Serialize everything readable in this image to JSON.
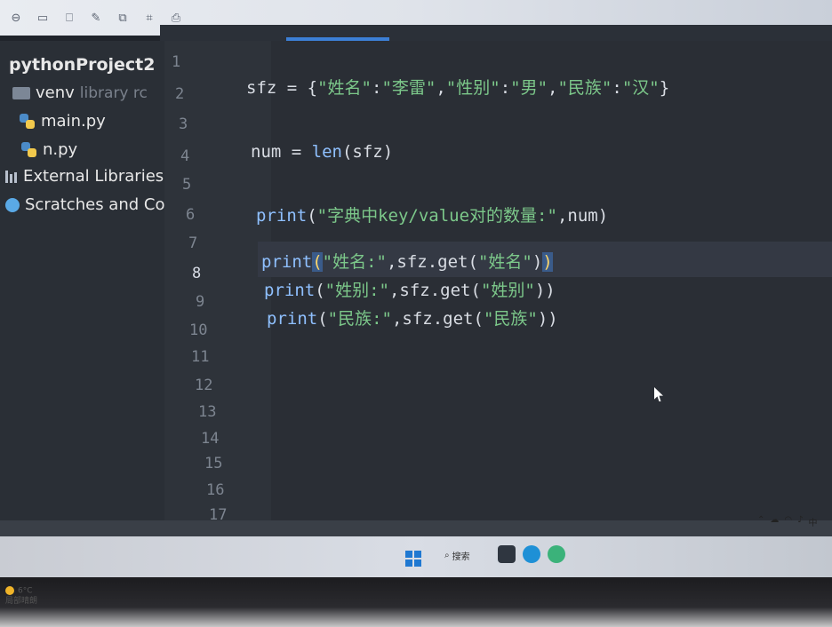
{
  "sidebar": {
    "project": "pythonProject2",
    "items": [
      {
        "label": "venv",
        "hint": "library rc",
        "icon": "folder-icon"
      },
      {
        "label": "main.py",
        "icon": "python-file-icon"
      },
      {
        "label": "n.py",
        "icon": "python-file-icon"
      },
      {
        "label": "External Libraries",
        "icon": "library-icon"
      },
      {
        "label": "Scratches and Co",
        "icon": "scratches-icon"
      }
    ]
  },
  "editor": {
    "line_numbers": [
      "1",
      "2",
      "3",
      "4",
      "5",
      "6",
      "7",
      "8",
      "9",
      "10",
      "11",
      "12",
      "13",
      "14",
      "15",
      "16",
      "17"
    ],
    "active_line": "8",
    "code": {
      "line2": {
        "var": "sfz",
        "op": " = ",
        "open": "{",
        "k1": "\"姓名\"",
        "c1": ":",
        "v1": "\"李雷\"",
        "s1": ",",
        "k2": "\"性别\"",
        "c2": ":",
        "v2": "\"男\"",
        "s2": ",",
        "k3": "\"民族\"",
        "c3": ":",
        "v3": "\"汉\"",
        "close": "}"
      },
      "line4": {
        "var": "num",
        "op": " = ",
        "fn": "len",
        "args": "(sfz)"
      },
      "line6": {
        "fn": "print",
        "open": "(",
        "str": "\"字典中key/value对的数量:\"",
        "rest": ",num)"
      },
      "line8": {
        "fn": "print",
        "open": "(",
        "str": "\"姓名:\"",
        "mid": ",sfz.get(",
        "arg": "\"姓名\"",
        "close1": ")",
        "close2": ")"
      },
      "line9": {
        "fn": "print",
        "open": "(",
        "str": "\"姓别:\"",
        "mid": ",sfz.get(",
        "arg": "\"姓别\"",
        "close": "))"
      },
      "line10": {
        "fn": "print",
        "open": "(",
        "str": "\"民族:\"",
        "mid": ",sfz.get(",
        "arg": "\"民族\"",
        "close": "))"
      }
    }
  },
  "taskbar": {
    "search_label": "搜索",
    "tray_text": "中",
    "weather_temp": "6°C",
    "weather_desc": "局部晴朗"
  },
  "colors": {
    "keyword": "#c8a8ff",
    "string": "#7cc88a",
    "function": "#8fc0ff",
    "accent": "#3c7fd6"
  }
}
